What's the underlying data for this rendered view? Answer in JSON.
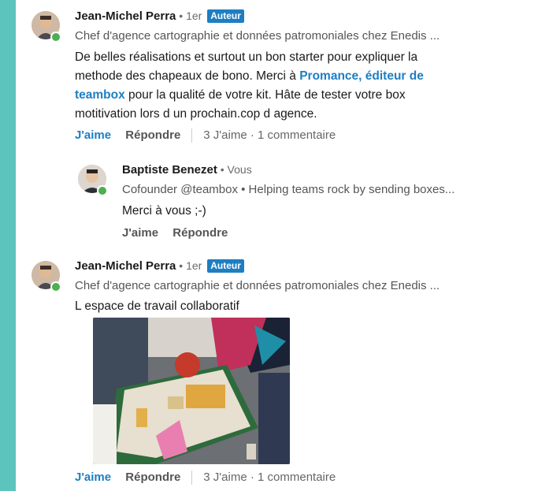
{
  "comments": [
    {
      "author": "Jean-Michel Perra",
      "meta": " • 1er ",
      "badge": "Auteur",
      "headline": "Chef d'agence cartographie et données patromoniales chez Enedis ...",
      "text_lines": [
        "De belles réalisations et surtout un bon starter pour expliquer la",
        "methode des chapeaux de bono. Merci à ",
        "teambox",
        " pour la qualité de votre kit. Hâte de tester votre box",
        "motitivation lors d un prochain.cop d agence."
      ],
      "link_text_1": "Promance, éditeur de",
      "like": "J'aime",
      "reply": "Répondre",
      "stats": "3 J'aime  ·  1 commentaire"
    },
    {
      "author": "Baptiste Benezet",
      "meta": " • Vous",
      "headline": "Cofounder @teambox • Helping teams rock by sending boxes...",
      "text": "Merci à vous ;-)",
      "like": "J'aime",
      "reply": "Répondre"
    },
    {
      "author": "Jean-Michel Perra",
      "meta": " • 1er ",
      "badge": "Auteur",
      "headline": "Chef d'agence cartographie et données patromoniales chez Enedis ...",
      "text": "L espace de travail collaboratif",
      "like": "J'aime",
      "reply": "Répondre",
      "stats": "3 J'aime  ·  1 commentaire"
    }
  ],
  "colors": {
    "accent": "#1d7ec2",
    "presence": "#4caf50",
    "background": "#5cc4bd"
  }
}
